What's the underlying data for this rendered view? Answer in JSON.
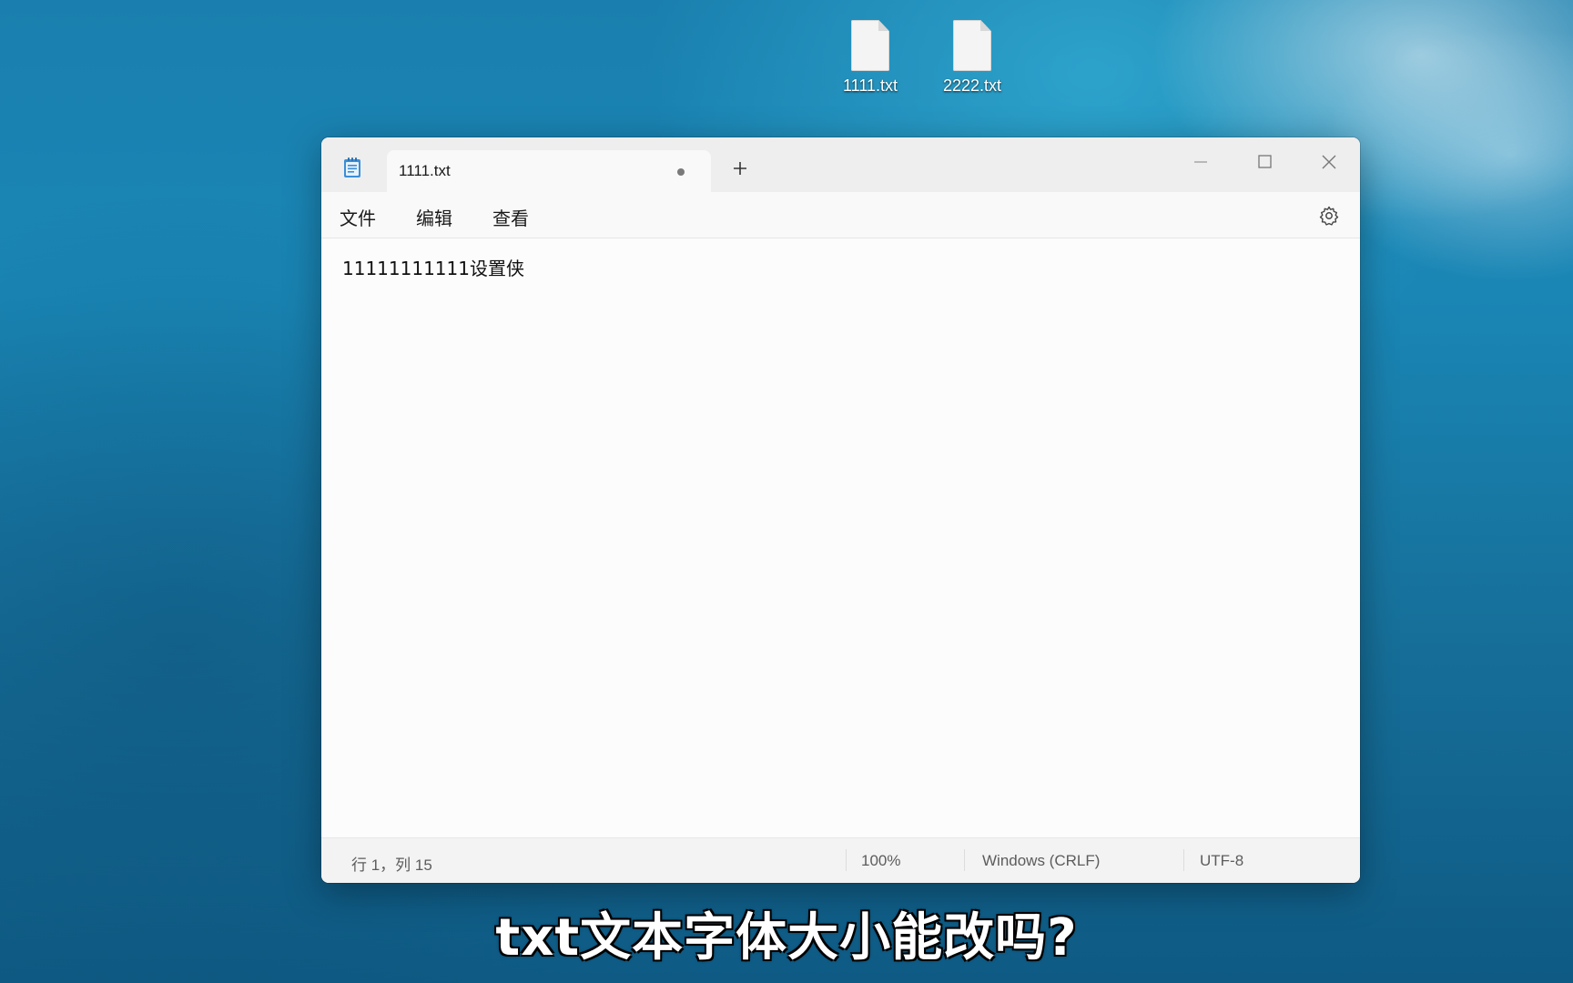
{
  "desktop": {
    "icons": [
      {
        "label": "1111.txt",
        "icon": "text-file-icon"
      },
      {
        "label": "2222.txt",
        "icon": "text-file-icon"
      }
    ]
  },
  "window": {
    "tab": {
      "title": "1111.txt",
      "unsaved": true
    },
    "menu": {
      "file": "文件",
      "edit": "编辑",
      "view": "查看"
    },
    "editor": {
      "content": "11111111111设置侠"
    },
    "status": {
      "position": "行 1，列 15",
      "zoom": "100%",
      "line_ending": "Windows (CRLF)",
      "encoding": "UTF-8"
    }
  },
  "subtitle": "txt文本字体大小能改吗?"
}
